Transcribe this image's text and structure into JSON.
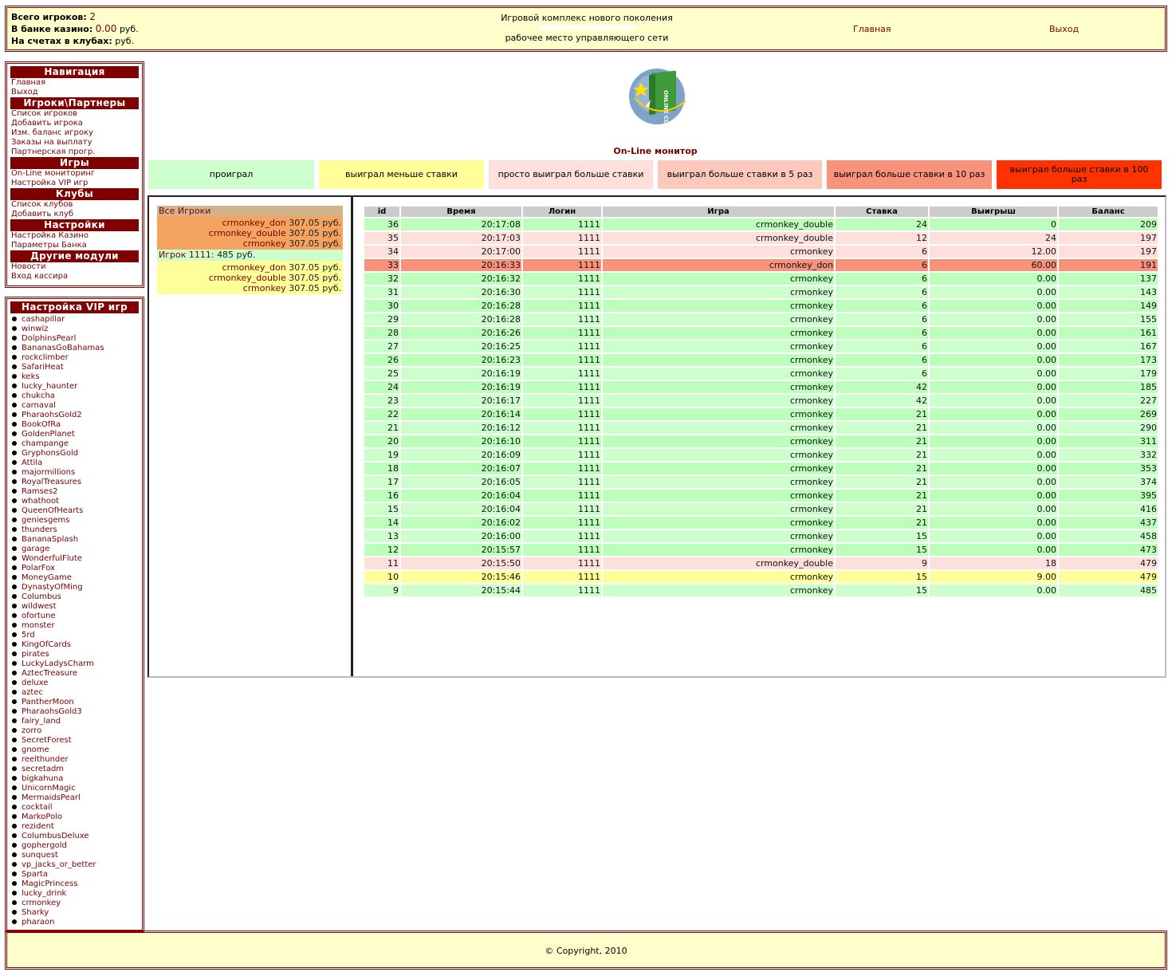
{
  "header": {
    "total_players_label": "Всего игроков:",
    "total_players": "2",
    "bank_label": "В банке казино:",
    "bank_value": "0.00",
    "bank_unit": "руб.",
    "accounts_label": "На счетах в клубах:",
    "accounts_unit": "руб.",
    "title_top": "Игровой комплекс нового поколения",
    "title_bottom": "рабочее место управляющего сети",
    "home": "Главная",
    "exit": "Выход"
  },
  "nav": {
    "sections": [
      {
        "title": "Навигация",
        "items": [
          "Главная",
          "Выход"
        ]
      },
      {
        "title": "Игроки\\Партнеры",
        "items": [
          "Список игроков",
          "Добавить игрока",
          "Изм. баланс игроку",
          "Заказы на выплату",
          "Партнерская прогр."
        ]
      },
      {
        "title": "Игры",
        "items": [
          "On-Line мониторинг",
          "Настройка VIP игр"
        ]
      },
      {
        "title": "Клубы",
        "items": [
          "Список клубов",
          "Добавить клуб"
        ]
      },
      {
        "title": "Настройки",
        "items": [
          "Настройка Казино",
          "Параметры Банка"
        ]
      },
      {
        "title": "Другие модули",
        "items": [
          "Новости",
          "Вход кассира"
        ]
      }
    ]
  },
  "vip": {
    "title": "Настройка VIP игр",
    "games": [
      "cashapillar",
      "winwiz",
      "DolphinsPearl",
      "BananasGoBahamas",
      "rockclimber",
      "SafariHeat",
      "keks",
      "lucky_haunter",
      "chukcha",
      "carnaval",
      "PharaohsGold2",
      "BookOfRa",
      "GoldenPlanet",
      "champange",
      "GryphonsGold",
      "Attila",
      "majormillions",
      "RoyalTreasures",
      "Ramses2",
      "whathoot",
      "QueenOfHearts",
      "geniesgems",
      "thunders",
      "BananaSplash",
      "garage",
      "WonderfulFlute",
      "PolarFox",
      "MoneyGame",
      "DynastyOfMing",
      "Columbus",
      "wildwest",
      "ofortune",
      "monster",
      "5rd",
      "KingOfCards",
      "pirates",
      "LuckyLadysCharm",
      "AztecTreasure",
      "deluxe",
      "aztec",
      "PantherMoon",
      "PharaohsGold3",
      "fairy_land",
      "zorro",
      "SecretForest",
      "gnome",
      "reelthunder",
      "secretadm",
      "bigkahuna",
      "UnicornMagic",
      "MermaidsPearl",
      "cocktail",
      "MarkoPolo",
      "rezident",
      "ColumbusDeluxe",
      "gophergold",
      "sunquest",
      "vp_jacks_or_better",
      "Sparta",
      "MagicPrincess",
      "lucky_drink",
      "crmonkey",
      "Sharky",
      "pharaon"
    ]
  },
  "monitor": {
    "logo_text": "ONLINE CONTROL",
    "title": "On-Line монитор",
    "legend": [
      {
        "label": "проиграл",
        "color": "#ccffcc"
      },
      {
        "label": "выиграл меньше ставки",
        "color": "#ffff99"
      },
      {
        "label": "просто выиграл больше ставки",
        "color": "#fde0dc"
      },
      {
        "label": "выиграл больше ставки в 5 раз",
        "color": "#fcc8bc"
      },
      {
        "label": "выиграл больше ставки в 10 раз",
        "color": "#f8927a"
      },
      {
        "label": "выиграл больше ставки в 100 раз",
        "color": "#ff3300"
      }
    ]
  },
  "players": {
    "all_label": "Все Игроки",
    "all_games": [
      {
        "game": "crmonkey_don",
        "amount": "307.05 руб."
      },
      {
        "game": "crmonkey_double",
        "amount": "307.05 руб."
      },
      {
        "game": "crmonkey",
        "amount": "307.05 руб."
      }
    ],
    "player_label": "Игрок 1111:",
    "player_amount": "485 руб.",
    "player_games": [
      {
        "game": "crmonkey_don",
        "amount": "307.05 руб."
      },
      {
        "game": "crmonkey_double",
        "amount": "307.05 руб."
      },
      {
        "game": "crmonkey",
        "amount": "307.05 руб."
      }
    ]
  },
  "log": {
    "columns": [
      "id",
      "Время",
      "Логин",
      "Игра",
      "Ставка",
      "Выигрыш",
      "Баланс"
    ],
    "rows": [
      {
        "id": "36",
        "time": "20:17:08",
        "login": "1111",
        "game": "crmonkey_double",
        "bet": "24",
        "win": "0",
        "balance": "209",
        "kind": "lose"
      },
      {
        "id": "35",
        "time": "20:17:03",
        "login": "1111",
        "game": "crmonkey_double",
        "bet": "12",
        "win": "24",
        "balance": "197",
        "kind": "win"
      },
      {
        "id": "34",
        "time": "20:17:00",
        "login": "1111",
        "game": "crmonkey",
        "bet": "6",
        "win": "12.00",
        "balance": "197",
        "kind": "win"
      },
      {
        "id": "33",
        "time": "20:16:33",
        "login": "1111",
        "game": "crmonkey_don",
        "bet": "6",
        "win": "60.00",
        "balance": "191",
        "kind": "win10"
      },
      {
        "id": "32",
        "time": "20:16:32",
        "login": "1111",
        "game": "crmonkey",
        "bet": "6",
        "win": "0.00",
        "balance": "137",
        "kind": "lose"
      },
      {
        "id": "31",
        "time": "20:16:30",
        "login": "1111",
        "game": "crmonkey",
        "bet": "6",
        "win": "0.00",
        "balance": "143",
        "kind": "lose"
      },
      {
        "id": "30",
        "time": "20:16:28",
        "login": "1111",
        "game": "crmonkey",
        "bet": "6",
        "win": "0.00",
        "balance": "149",
        "kind": "lose"
      },
      {
        "id": "29",
        "time": "20:16:28",
        "login": "1111",
        "game": "crmonkey",
        "bet": "6",
        "win": "0.00",
        "balance": "155",
        "kind": "lose"
      },
      {
        "id": "28",
        "time": "20:16:26",
        "login": "1111",
        "game": "crmonkey",
        "bet": "6",
        "win": "0.00",
        "balance": "161",
        "kind": "lose"
      },
      {
        "id": "27",
        "time": "20:16:25",
        "login": "1111",
        "game": "crmonkey",
        "bet": "6",
        "win": "0.00",
        "balance": "167",
        "kind": "lose"
      },
      {
        "id": "26",
        "time": "20:16:23",
        "login": "1111",
        "game": "crmonkey",
        "bet": "6",
        "win": "0.00",
        "balance": "173",
        "kind": "lose"
      },
      {
        "id": "25",
        "time": "20:16:19",
        "login": "1111",
        "game": "crmonkey",
        "bet": "6",
        "win": "0.00",
        "balance": "179",
        "kind": "lose"
      },
      {
        "id": "24",
        "time": "20:16:19",
        "login": "1111",
        "game": "crmonkey",
        "bet": "42",
        "win": "0.00",
        "balance": "185",
        "kind": "lose"
      },
      {
        "id": "23",
        "time": "20:16:17",
        "login": "1111",
        "game": "crmonkey",
        "bet": "42",
        "win": "0.00",
        "balance": "227",
        "kind": "lose"
      },
      {
        "id": "22",
        "time": "20:16:14",
        "login": "1111",
        "game": "crmonkey",
        "bet": "21",
        "win": "0.00",
        "balance": "269",
        "kind": "lose"
      },
      {
        "id": "21",
        "time": "20:16:12",
        "login": "1111",
        "game": "crmonkey",
        "bet": "21",
        "win": "0.00",
        "balance": "290",
        "kind": "lose"
      },
      {
        "id": "20",
        "time": "20:16:10",
        "login": "1111",
        "game": "crmonkey",
        "bet": "21",
        "win": "0.00",
        "balance": "311",
        "kind": "lose"
      },
      {
        "id": "19",
        "time": "20:16:09",
        "login": "1111",
        "game": "crmonkey",
        "bet": "21",
        "win": "0.00",
        "balance": "332",
        "kind": "lose"
      },
      {
        "id": "18",
        "time": "20:16:07",
        "login": "1111",
        "game": "crmonkey",
        "bet": "21",
        "win": "0.00",
        "balance": "353",
        "kind": "lose"
      },
      {
        "id": "17",
        "time": "20:16:05",
        "login": "1111",
        "game": "crmonkey",
        "bet": "21",
        "win": "0.00",
        "balance": "374",
        "kind": "lose"
      },
      {
        "id": "16",
        "time": "20:16:04",
        "login": "1111",
        "game": "crmonkey",
        "bet": "21",
        "win": "0.00",
        "balance": "395",
        "kind": "lose"
      },
      {
        "id": "15",
        "time": "20:16:04",
        "login": "1111",
        "game": "crmonkey",
        "bet": "21",
        "win": "0.00",
        "balance": "416",
        "kind": "lose"
      },
      {
        "id": "14",
        "time": "20:16:02",
        "login": "1111",
        "game": "crmonkey",
        "bet": "21",
        "win": "0.00",
        "balance": "437",
        "kind": "lose"
      },
      {
        "id": "13",
        "time": "20:16:00",
        "login": "1111",
        "game": "crmonkey",
        "bet": "15",
        "win": "0.00",
        "balance": "458",
        "kind": "lose"
      },
      {
        "id": "12",
        "time": "20:15:57",
        "login": "1111",
        "game": "crmonkey",
        "bet": "15",
        "win": "0.00",
        "balance": "473",
        "kind": "lose"
      },
      {
        "id": "11",
        "time": "20:15:50",
        "login": "1111",
        "game": "crmonkey_double",
        "bet": "9",
        "win": "18",
        "balance": "479",
        "kind": "win"
      },
      {
        "id": "10",
        "time": "20:15:46",
        "login": "1111",
        "game": "crmonkey",
        "bet": "15",
        "win": "9.00",
        "balance": "479",
        "kind": "less"
      },
      {
        "id": "9",
        "time": "20:15:44",
        "login": "1111",
        "game": "crmonkey",
        "bet": "15",
        "win": "0.00",
        "balance": "485",
        "kind": "lose"
      }
    ]
  },
  "footer": {
    "copyright": "© Copyright, 2010"
  }
}
